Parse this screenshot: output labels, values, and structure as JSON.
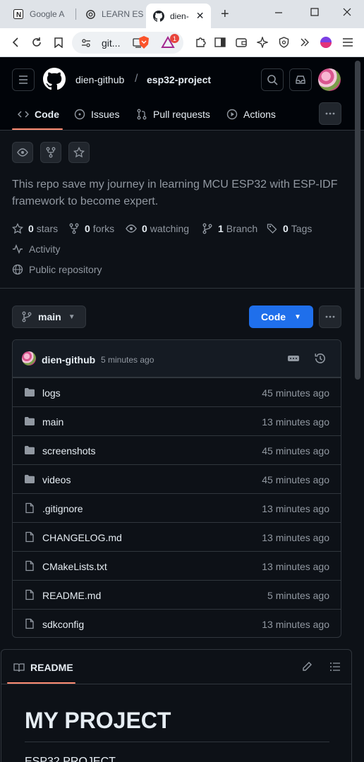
{
  "browser": {
    "tabs": [
      {
        "label": "Google A",
        "icon": "notion-icon"
      },
      {
        "label": "LEARN ES",
        "icon": "openai-icon"
      },
      {
        "label": "dien-",
        "icon": "github-icon",
        "active": true
      }
    ],
    "close_tab": "✕",
    "new_tab": "+",
    "url": "git...",
    "brave_badge": "1"
  },
  "header": {
    "owner": "dien-github",
    "separator": "/",
    "repo": "esp32-project",
    "nav": [
      {
        "label": "Code",
        "icon": "code-icon",
        "selected": true
      },
      {
        "label": "Issues",
        "icon": "issue-icon"
      },
      {
        "label": "Pull requests",
        "icon": "pull-request-icon"
      },
      {
        "label": "Actions",
        "icon": "actions-play-icon"
      }
    ]
  },
  "repo": {
    "description": "This repo save my journey in learning MCU ESP32 with ESP-IDF framework to become expert.",
    "stats": [
      {
        "count": "0",
        "label": "stars"
      },
      {
        "count": "0",
        "label": "forks"
      },
      {
        "count": "0",
        "label": "watching"
      },
      {
        "count": "1",
        "label": "Branch"
      },
      {
        "count": "0",
        "label": "Tags"
      }
    ],
    "activity": "Activity",
    "visibility": "Public repository"
  },
  "branch": {
    "name": "main",
    "code_label": "Code"
  },
  "commit": {
    "author": "dien-github",
    "time": "5 minutes ago"
  },
  "files": [
    {
      "name": "logs",
      "type": "folder",
      "time": "45 minutes ago"
    },
    {
      "name": "main",
      "type": "folder",
      "time": "13 minutes ago"
    },
    {
      "name": "screenshots",
      "type": "folder",
      "time": "45 minutes ago"
    },
    {
      "name": "videos",
      "type": "folder",
      "time": "45 minutes ago"
    },
    {
      "name": ".gitignore",
      "type": "file",
      "time": "13 minutes ago"
    },
    {
      "name": "CHANGELOG.md",
      "type": "file",
      "time": "13 minutes ago"
    },
    {
      "name": "CMakeLists.txt",
      "type": "file",
      "time": "13 minutes ago"
    },
    {
      "name": "README.md",
      "type": "file",
      "time": "5 minutes ago"
    },
    {
      "name": "sdkconfig",
      "type": "file",
      "time": "13 minutes ago"
    }
  ],
  "readme": {
    "tab_label": "README",
    "h1": "MY PROJECT",
    "h2": "ESP32 PROJECT"
  },
  "colors": {
    "accent": "#1f6feb",
    "tab_underline": "#fd8c73",
    "background": "#0d1117"
  }
}
